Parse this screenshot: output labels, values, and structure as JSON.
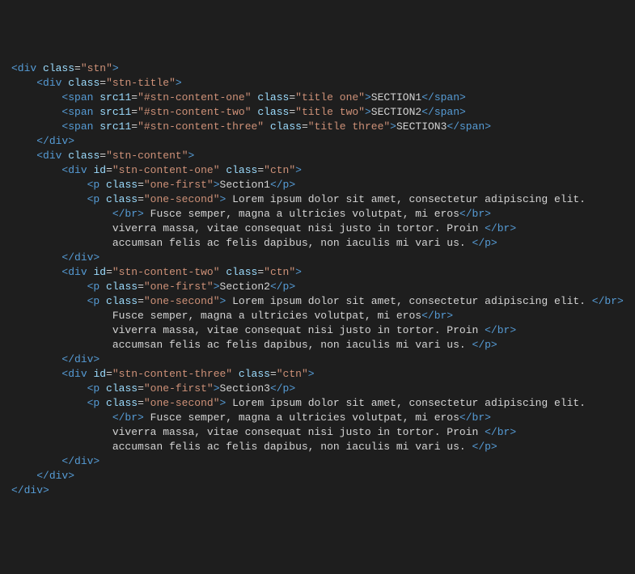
{
  "code": {
    "root": {
      "tag": "div",
      "cls": "stn"
    },
    "title_wrap": {
      "tag": "div",
      "cls": "stn-title"
    },
    "titles": [
      {
        "tag": "span",
        "srcAttr": "src11",
        "srcVal": "#stn-content-one",
        "cls": "title one",
        "text": "SECTION1"
      },
      {
        "tag": "span",
        "srcAttr": "src11",
        "srcVal": "#stn-content-two",
        "cls": "title two",
        "text": "SECTION2"
      },
      {
        "tag": "span",
        "srcAttr": "src11",
        "srcVal": "#stn-content-three",
        "cls": "title three",
        "text": "SECTION3"
      }
    ],
    "content_wrap": {
      "tag": "div",
      "cls": "stn-content"
    },
    "sections": [
      {
        "id": "stn-content-one",
        "cls": "ctn",
        "p1_cls": "one-first",
        "p1_text": "Section1",
        "p2_cls": "one-second",
        "p2_line1": " Lorem ipsum dolor sit amet, consectetur adipiscing elit.",
        "p2_line2": " Fusce semper, magna a ultricies volutpat, mi eros",
        "p2_line3": "viverra massa, vitae consequat nisi justo in tortor. Proin ",
        "p2_line4": "accumsan felis ac felis dapibus, non iaculis mi vari us. ",
        "variant": 1
      },
      {
        "id": "stn-content-two",
        "cls": "ctn",
        "p1_cls": "one-first",
        "p1_text": "Section2",
        "p2_cls": "one-second",
        "p2_line1": " Lorem ipsum dolor sit amet, consectetur adipiscing elit. ",
        "p2_line2": "Fusce semper, magna a ultricies volutpat, mi eros",
        "p2_line3": "viverra massa, vitae consequat nisi justo in tortor. Proin ",
        "p2_line4": "accumsan felis ac felis dapibus, non iaculis mi vari us. ",
        "variant": 2
      },
      {
        "id": "stn-content-three",
        "cls": "ctn",
        "p1_cls": "one-first",
        "p1_text": "Section3",
        "p2_cls": "one-second",
        "p2_line1": " Lorem ipsum dolor sit amet, consectetur adipiscing elit.",
        "p2_line2": " Fusce semper, magna a ultricies volutpat, mi eros",
        "p2_line3": "viverra massa, vitae consequat nisi justo in tortor. Proin ",
        "p2_line4": "accumsan felis ac felis dapibus, non iaculis mi vari us. ",
        "variant": 1
      }
    ],
    "close_div": "div",
    "p_tag": "p",
    "br_tag": "br"
  }
}
